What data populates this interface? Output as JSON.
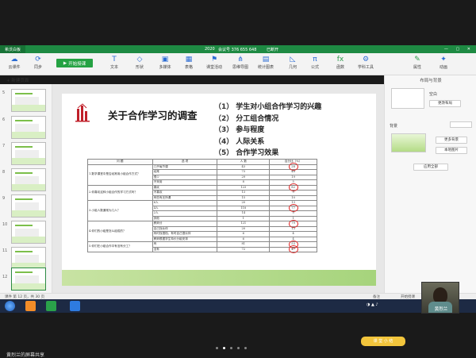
{
  "app": {
    "name": "希沃白板",
    "doc_title": "2020",
    "meeting": "会议号 376 655 648",
    "status": "已断开"
  },
  "toolbar": {
    "cloud": "云课件",
    "sync": "同步",
    "start": "开始授课",
    "items": [
      "文本",
      "形状",
      "多媒体",
      "表格",
      "课堂活动",
      "思维导图",
      "统计图表",
      "几何",
      "公式",
      "函数",
      "学科工具"
    ],
    "right": [
      "属性",
      "动画"
    ]
  },
  "left": {
    "new_page": "+ 新建页面",
    "thumb_numbers": [
      "5",
      "6",
      "7",
      "8",
      "9",
      "10",
      "11",
      "12"
    ]
  },
  "slide": {
    "title": "关于合作学习的调查",
    "goals": [
      {
        "n": "（1）",
        "t": "学生对小组合作学习的兴趣"
      },
      {
        "n": "（2）",
        "t": "分工组合情况"
      },
      {
        "n": "（3）",
        "t": "参与程度"
      },
      {
        "n": "（4）",
        "t": "人际关系"
      },
      {
        "n": "（5）",
        "t": "合作学习效果"
      }
    ],
    "table_headers": [
      "问 题",
      "选 项",
      "人 数",
      "百分比（%）"
    ],
    "rows": [
      [
        "1.数学课堂中是否经常用小组合作方式？",
        "几乎每节课",
        "43",
        "28"
      ],
      [
        "",
        "经常",
        "73",
        "48"
      ],
      [
        "",
        "很少",
        "29",
        "19"
      ],
      [
        "",
        "不采用",
        "8",
        "5"
      ],
      [
        "2.你喜欢这种小组合作的学习方式吗？",
        "喜欢",
        "123",
        "82"
      ],
      [
        "",
        "不喜欢",
        "13",
        "9"
      ],
      [
        "",
        "有些有无所谓",
        "15",
        "10"
      ],
      [
        "3.小组人数通常为几人？",
        "6人",
        "20",
        "13"
      ],
      [
        "",
        "4人",
        "118",
        "77"
      ],
      [
        "",
        "2人",
        "14",
        "9"
      ],
      [
        "",
        "其他",
        "1",
        "1"
      ],
      [
        "4.你们的小组是怎么组成的？",
        "教师分",
        "121",
        "79"
      ],
      [
        "",
        "自己找伙伴",
        "20",
        "13"
      ],
      [
        "",
        "有时找搭档，有时自己搭伙伴",
        "6",
        "4"
      ],
      [
        "",
        "教师根据学生特长分组安排",
        "6",
        "4"
      ],
      [
        "5.你们在小组合作中有没有分工？",
        "有",
        "81",
        "53"
      ],
      [
        "",
        "没有",
        "72",
        "47"
      ]
    ],
    "circled": [
      "28",
      "82",
      "77",
      "79",
      "53",
      "47"
    ],
    "banner": "课 堂 小 结"
  },
  "right_panel": {
    "title": "布局与背景",
    "blank": "空白",
    "change_layout": "更改布局",
    "background_label": "背景",
    "more_bg": "更多背景",
    "local_image": "本地图片",
    "apply_all": "应用全部"
  },
  "statusbar": {
    "page": "课件 第 12 页，共 30 页",
    "notes": "备注",
    "start": "开始授课"
  },
  "presenter": "黄烈兰",
  "caption": "黄烈兰的屏幕共享",
  "colors": {
    "brand_green": "#1e8a43",
    "start_green": "#25a243",
    "circle_red": "#e02c2c"
  }
}
